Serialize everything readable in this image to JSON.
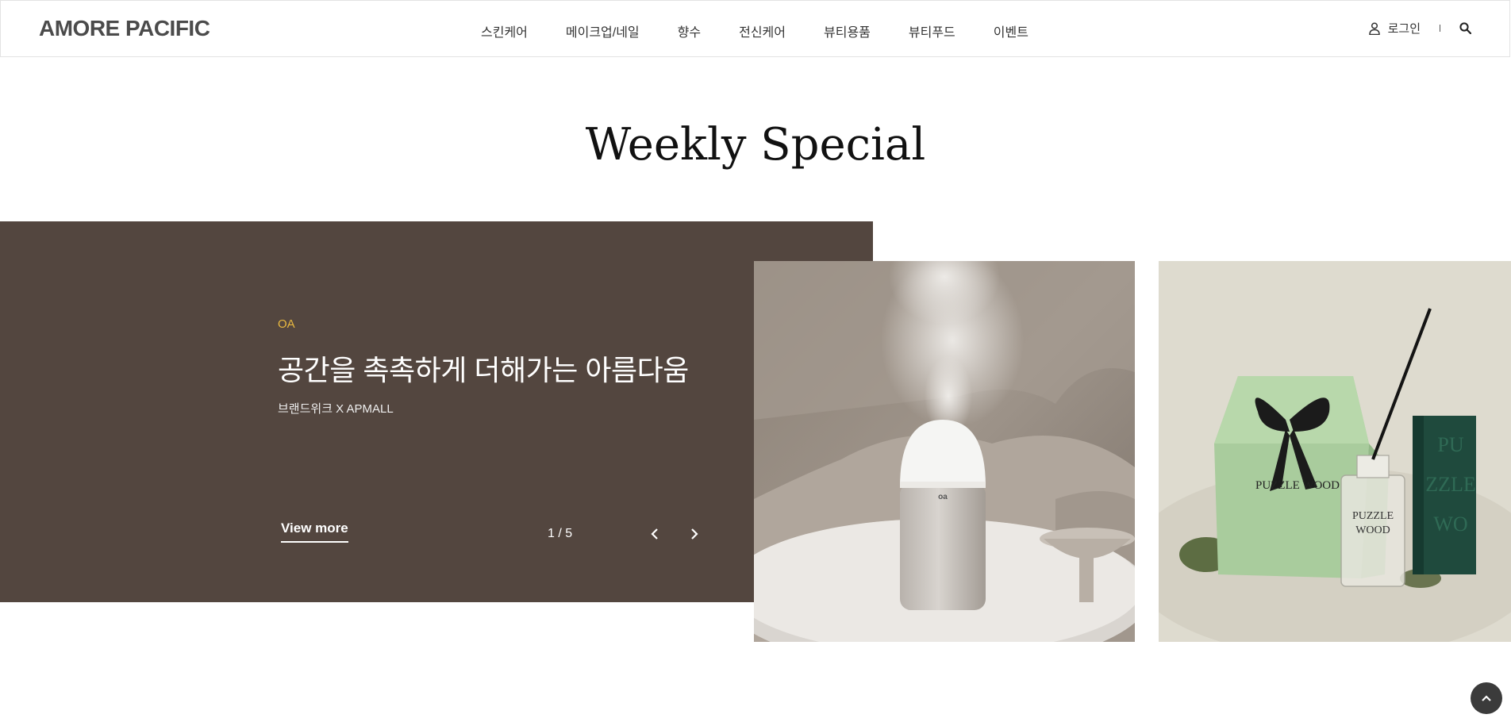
{
  "header": {
    "logo": "AMORE PACIFIC",
    "nav": [
      "스킨케어",
      "메이크업/네일",
      "향수",
      "전신케어",
      "뷰티용품",
      "뷰티푸드",
      "이벤트"
    ],
    "login_label": "로그인",
    "icons": {
      "user": "user-icon",
      "search": "search-icon"
    }
  },
  "section": {
    "title": "Weekly Special"
  },
  "banner": {
    "brand": "OA",
    "headline": "공간을 촉촉하게 더해가는 아름다움",
    "sub": "브랜드위크 X APMALL",
    "view_more": "View more",
    "counter": "1 / 5",
    "icons": {
      "prev": "chevron-left-icon",
      "next": "chevron-right-icon"
    },
    "colors": {
      "background": "#53463f",
      "brand_accent": "#e8b840"
    }
  },
  "products": [
    {
      "name": "humidifier-product-image"
    },
    {
      "name": "puzzle-wood-diffuser-image",
      "box_text": "PUZZLE WOOD"
    }
  ],
  "scroll_top": {
    "icon": "chevron-up-icon"
  }
}
